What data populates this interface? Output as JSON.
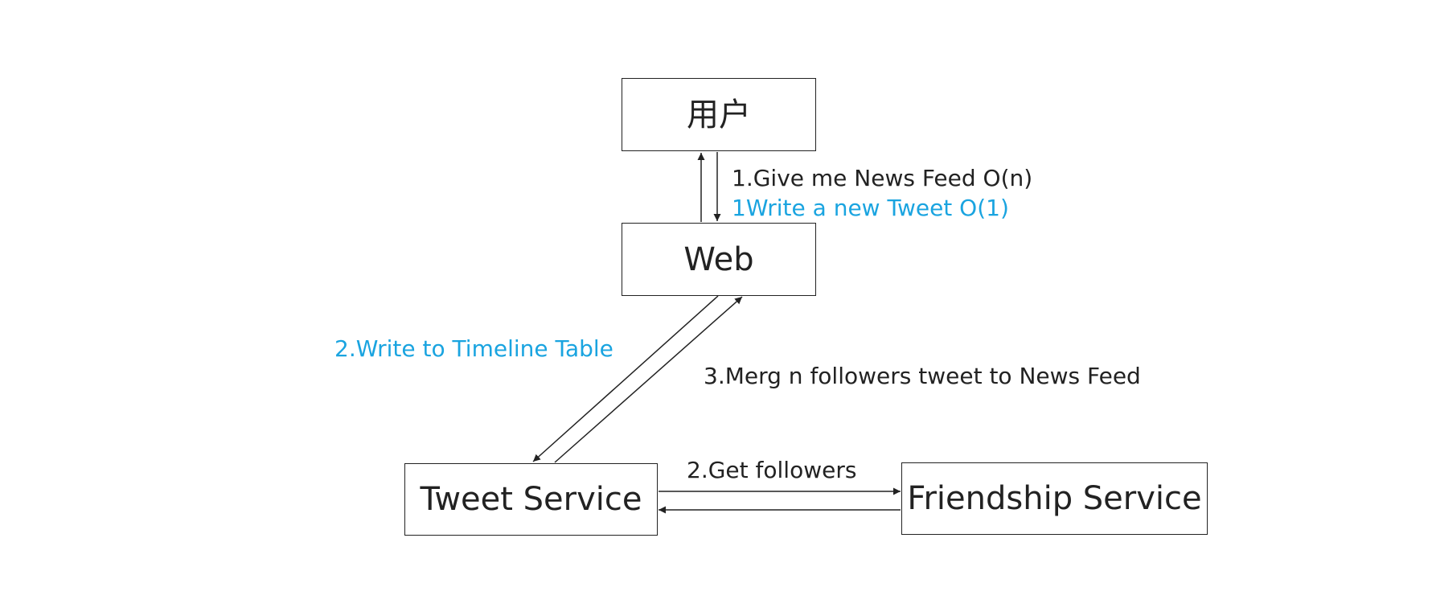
{
  "colors": {
    "text": "#222222",
    "accent": "#1aa4e0",
    "line": "#222222"
  },
  "nodes": {
    "user": "用户",
    "web": "Web",
    "tweet_service": "Tweet Service",
    "friendship_service": "Friendship Service"
  },
  "labels": {
    "give_news_feed": "1.Give me News Feed O(n)",
    "write_new_tweet": "1Write a new Tweet O(1)",
    "write_timeline": "2.Write to Timeline Table",
    "merge_followers": "3.Merg n followers tweet to News Feed",
    "get_followers": "2.Get followers"
  }
}
